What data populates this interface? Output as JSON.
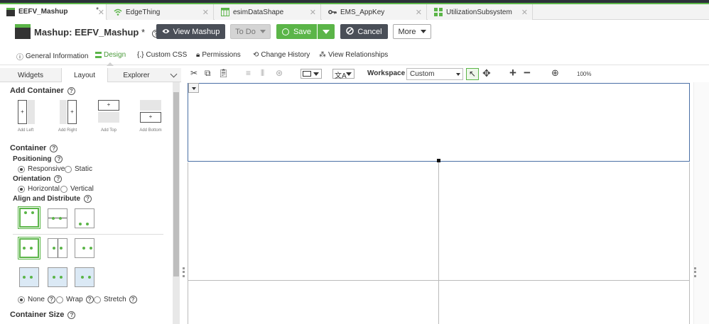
{
  "tabs": [
    {
      "label": "EEFV_Mashup",
      "modified": "*",
      "icon": "mashup-icon",
      "active": true
    },
    {
      "label": "EdgeThing",
      "icon": "wifi-thing-icon"
    },
    {
      "label": "esimDataShape",
      "icon": "datashape-icon"
    },
    {
      "label": "EMS_AppKey",
      "icon": "key-icon"
    },
    {
      "label": "UtilizationSubsystem",
      "icon": "subsystem-icon"
    }
  ],
  "header": {
    "title": "Mashup: EEFV_Mashup",
    "modified": "*",
    "view_mashup": "View Mashup",
    "todo": "To Do",
    "save": "Save",
    "cancel": "Cancel",
    "more": "More"
  },
  "subnav": [
    {
      "label": "General Information",
      "icon": "info-icon"
    },
    {
      "label": "Design",
      "icon": "design-icon",
      "active": true
    },
    {
      "label": "Custom CSS",
      "icon": "css-icon"
    },
    {
      "label": "Permissions",
      "icon": "lock-icon"
    },
    {
      "label": "Change History",
      "icon": "history-icon"
    },
    {
      "label": "View Relationships",
      "icon": "relationships-icon"
    }
  ],
  "lefttabs": {
    "widgets": "Widgets",
    "layout": "Layout",
    "explorer": "Explorer"
  },
  "layout_panel": {
    "add_container": "Add Container",
    "add_left": "Add Left",
    "add_right": "Add Right",
    "add_top": "Add Top",
    "add_bottom": "Add Bottom",
    "container": "Container",
    "positioning": "Positioning",
    "responsive": "Responsive",
    "static": "Static",
    "orientation": "Orientation",
    "horizontal": "Horizontal",
    "vertical": "Vertical",
    "align_distribute": "Align and Distribute",
    "none": "None",
    "wrap": "Wrap",
    "stretch": "Stretch",
    "container_size": "Container Size"
  },
  "toolbar": {
    "workspace_label": "Workspace",
    "workspace_value": "Custom",
    "zoom": "100%"
  },
  "colors": {
    "accent": "#5bb548",
    "dark": "#4a4f58",
    "selection": "#4a6fa5"
  }
}
